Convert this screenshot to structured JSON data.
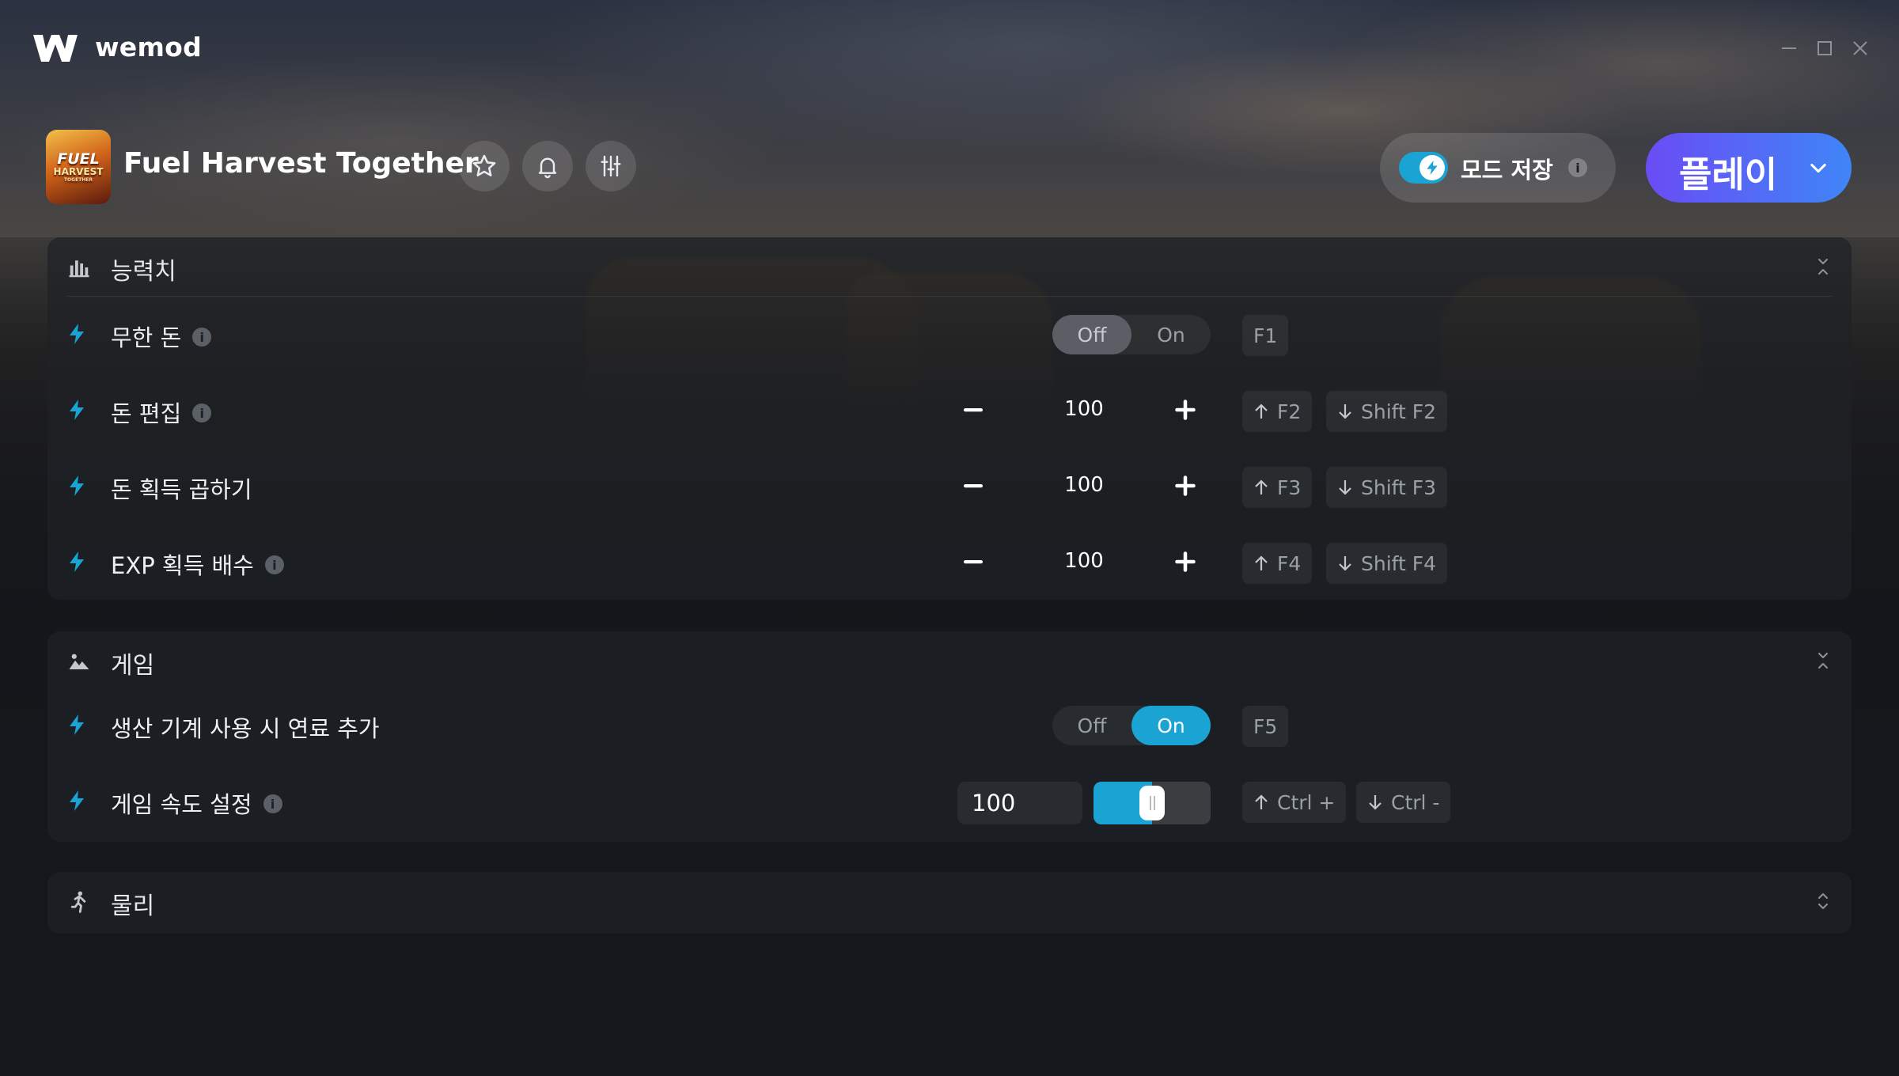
{
  "app": {
    "brand": "wemod"
  },
  "window_controls": [
    "minimize-icon",
    "maximize-icon",
    "close-icon"
  ],
  "game": {
    "title": "Fuel Harvest Together",
    "cover_text": [
      "FUEL",
      "HARVEST",
      "TOGETHER"
    ],
    "actions": [
      "star-icon",
      "bell-icon",
      "sliders-icon"
    ]
  },
  "mod_save": {
    "label": "모드 저장",
    "info": "i",
    "enabled": true
  },
  "play": {
    "label": "플레이"
  },
  "colors": {
    "accent": "#1aa3d3",
    "play_start": "#6a4cf5",
    "play_end": "#3f86f7",
    "bolt": "#1aa3d3"
  },
  "sections": [
    {
      "title": "능력치",
      "icon": "bar-chart-icon",
      "rows": [
        {
          "name": "무한 돈",
          "info": "i",
          "type": "toggle",
          "off": "Off",
          "on": "On",
          "state": "Off",
          "keys": [
            "F1"
          ]
        },
        {
          "name": "돈 편집",
          "info": "i",
          "type": "stepper",
          "minus": "−",
          "value": "100",
          "plus": "+",
          "keys": [
            "F2",
            "Shift F2"
          ]
        },
        {
          "name": "돈 획득 곱하기",
          "type": "stepper",
          "minus": "−",
          "value": "100",
          "plus": "+",
          "keys": [
            "F3",
            "Shift F3"
          ]
        },
        {
          "name": "EXP 획득 배수",
          "info": "i",
          "type": "stepper",
          "minus": "−",
          "value": "100",
          "plus": "+",
          "keys": [
            "F4",
            "Shift F4"
          ]
        }
      ]
    },
    {
      "title": "게임",
      "icon": "landscape-icon",
      "rows": [
        {
          "name": "생산 기계 사용 시 연료 추가",
          "type": "toggle",
          "off": "Off",
          "on": "On",
          "state": "On",
          "keys": [
            "F5"
          ]
        },
        {
          "name": "게임 속도 설정",
          "info": "i",
          "type": "slider",
          "value": "100",
          "level": 0.5,
          "keys": [
            "Ctrl +",
            "Ctrl -"
          ]
        }
      ]
    },
    {
      "title": "물리",
      "icon": "running-icon",
      "rows": []
    }
  ]
}
